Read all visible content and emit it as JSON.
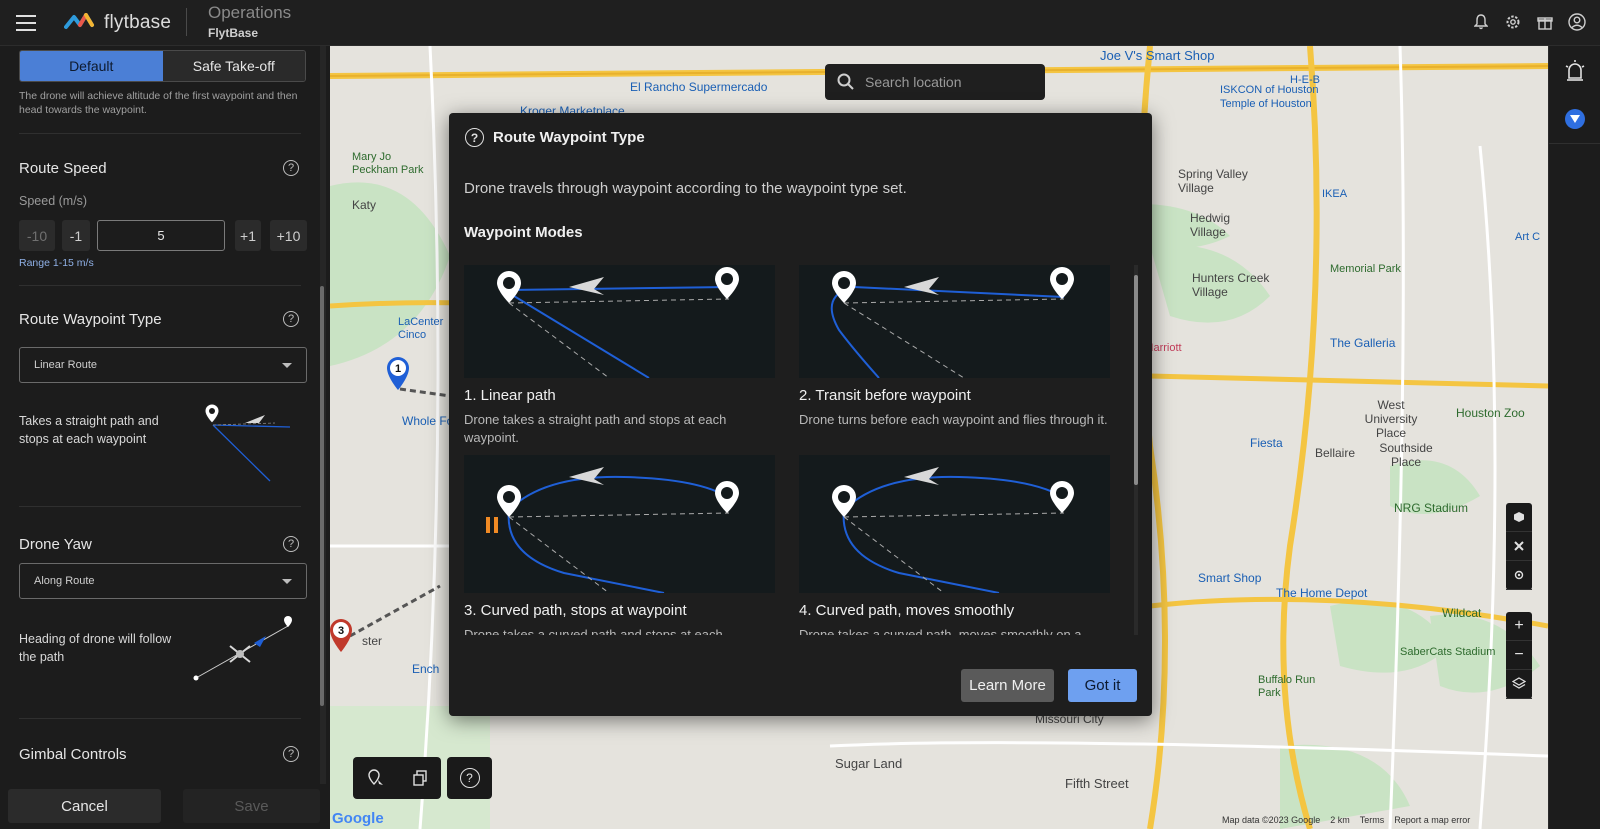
{
  "topbar": {
    "logo_text": "flytbase",
    "app_title": "Operations",
    "app_subtitle": "FlytBase",
    "icons": [
      "bell-icon",
      "gear-icon",
      "gift-icon",
      "account-icon"
    ]
  },
  "sidebar": {
    "mode_tabs": [
      "Default",
      "Safe Take-off"
    ],
    "active_mode": "Default",
    "mode_note": "The drone will achieve altitude of the first waypoint and then head towards the waypoint.",
    "route_speed": {
      "title": "Route Speed",
      "label": "Speed (m/s)",
      "buttons": [
        "-10",
        "-1",
        "+1",
        "+10"
      ],
      "value": "5",
      "range": "Range 1-15 m/s"
    },
    "waypoint_type": {
      "title": "Route Waypoint Type",
      "selected": "Linear Route",
      "description": "Takes a straight path and stops at each waypoint"
    },
    "drone_yaw": {
      "title": "Drone Yaw",
      "selected": "Along Route",
      "description": "Heading of drone will follow the path"
    },
    "gimbal": {
      "title": "Gimbal Controls"
    },
    "cancel_label": "Cancel",
    "save_label": "Save"
  },
  "search": {
    "placeholder": "Search location"
  },
  "modal": {
    "title": "Route Waypoint Type",
    "description": "Drone travels through waypoint according to the waypoint type set.",
    "subtitle": "Waypoint Modes",
    "cards": [
      {
        "title": "1. Linear path",
        "desc": "Drone takes a straight path and stops at each waypoint."
      },
      {
        "title": "2. Transit before waypoint",
        "desc": "Drone turns before each waypoint and flies through it."
      },
      {
        "title": "3. Curved path, stops at waypoint",
        "desc": "Drone takes a curved path and stops at each"
      },
      {
        "title": "4. Curved path, moves smoothly",
        "desc": "Drone takes a curved path, moves smoothly on a"
      }
    ],
    "learn_more_label": "Learn More",
    "got_it_label": "Got it"
  },
  "map": {
    "labels": [
      "Joe V's Smart Shop",
      "H-E-B",
      "El Rancho Supermercado",
      "Kroger Marketplace",
      "ISKCON of Houston",
      "Temple of Houston",
      "Mary Jo Peckham Park",
      "Spring Valley Village",
      "IKEA",
      "Katy",
      "Hedwig Village",
      "Hunters Creek Village",
      "Memorial Park",
      "The Galleria",
      "Art C",
      "LaCenter Cinco",
      "Whole Foods",
      "an Marriott",
      "West University Place",
      "Houston Zoo",
      "Bellaire",
      "Southside Place",
      "Fiesta",
      "NRG Stadium",
      "Smart Shop",
      "The Home Depot",
      "Wildcat",
      "SaberCats Stadium",
      "Buffalo Run Park",
      "Missouri City",
      "Sugar Land",
      "Fifth Street",
      "Ench",
      "ster"
    ],
    "waypoint_markers": [
      "1",
      "3"
    ],
    "attribution": "Map data ©2023 Google",
    "scale": "2 km",
    "terms": "Terms",
    "report": "Report a map error",
    "google": "Google"
  },
  "colors": {
    "accent": "#4b7fd6",
    "got_it": "#6ea0f0",
    "path_blue": "#1f5fd6"
  }
}
